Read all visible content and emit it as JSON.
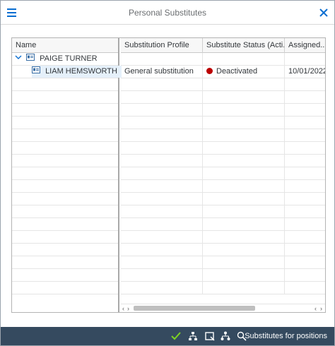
{
  "window": {
    "title": "Personal Substitutes"
  },
  "grid": {
    "columns": {
      "name": "Name",
      "profile": "Substitution Profile",
      "status": "Substitute Status (Acti...",
      "assigned": "Assigned..."
    },
    "tree": [
      {
        "label": "PAIGE TURNER",
        "level": 0,
        "expanded": true
      },
      {
        "label": "LIAM HEMSWORTH",
        "level": 1,
        "selected": true
      }
    ],
    "rows": [
      {
        "profile": "",
        "status": "",
        "assigned": ""
      },
      {
        "profile": "General substitution",
        "status": "Deactivated",
        "assigned": "10/01/2022"
      }
    ]
  },
  "scroll": {
    "left_arrow": "‹",
    "right_arrow": "›"
  },
  "footer": {
    "positions_label": "Substitutes for positions"
  },
  "colors": {
    "footer_bg": "#354a5f",
    "status_deactivated": "#bb0000",
    "accent": "#0a6ed1"
  }
}
